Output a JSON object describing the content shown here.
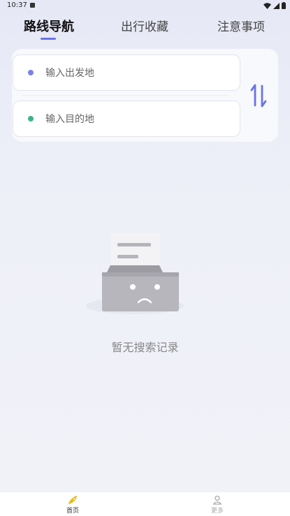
{
  "status_bar": {
    "time": "10:37"
  },
  "tabs": [
    {
      "label": "路线导航"
    },
    {
      "label": "出行收藏"
    },
    {
      "label": "注意事项"
    }
  ],
  "route": {
    "start_placeholder": "输入出发地",
    "end_placeholder": "输入目的地",
    "start_dot_color": "#7b80e8",
    "end_dot_color": "#3bb38f"
  },
  "empty_state": {
    "text": "暂无搜索记录"
  },
  "bottom_nav": {
    "home_label": "首页",
    "more_label": "更多"
  },
  "colors": {
    "accent": "#6b73e6"
  }
}
